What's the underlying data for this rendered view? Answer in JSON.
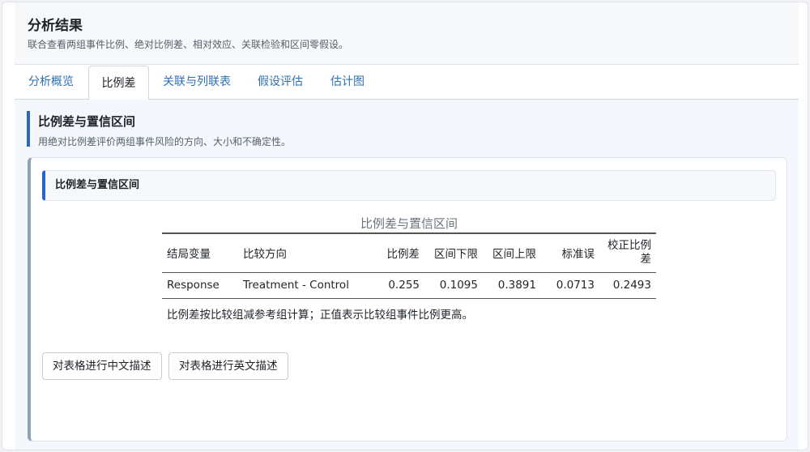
{
  "header": {
    "title": "分析结果",
    "subtitle": "联合查看两组事件比例、绝对比例差、相对效应、关联检验和区间零假设。"
  },
  "tabs": [
    {
      "label": "分析概览"
    },
    {
      "label": "比例差"
    },
    {
      "label": "关联与列联表"
    },
    {
      "label": "假设评估"
    },
    {
      "label": "估计图"
    }
  ],
  "active_tab": "比例差",
  "section": {
    "title": "比例差与置信区间",
    "description": "用绝对比例差评价两组事件风险的方向、大小和不确定性。"
  },
  "box": {
    "title": "比例差与置信区间"
  },
  "table": {
    "caption": "比例差与置信区间",
    "columns": [
      "结局变量",
      "比较方向",
      "比例差",
      "区间下限",
      "区间上限",
      "标准误",
      "校正比例差"
    ],
    "rows": [
      [
        "Response",
        "Treatment - Control",
        "0.255",
        "0.1095",
        "0.3891",
        "0.0713",
        "0.2493"
      ]
    ],
    "note": "比例差按比较组减参考组计算；正值表示比较组事件比例更高。"
  },
  "buttons": {
    "describe_cn": "对表格进行中文描述",
    "describe_en": "对表格进行英文描述"
  }
}
